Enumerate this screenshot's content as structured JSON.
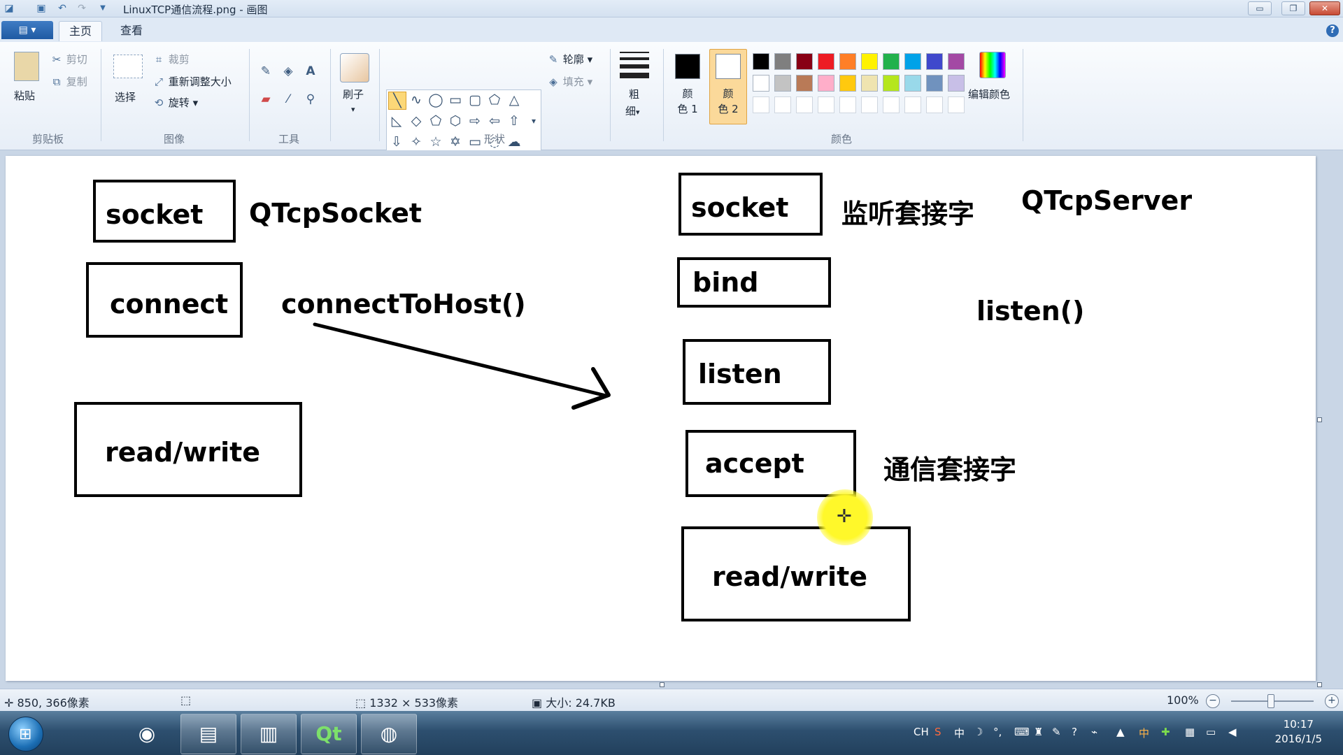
{
  "window": {
    "title": "LinuxTCP通信流程.png - 画图",
    "controls": {
      "minimize": "▭",
      "restore": "❐",
      "close": "✕"
    }
  },
  "quick_access": {
    "icons": [
      "paint-app-icon",
      "save-icon",
      "undo-icon",
      "redo-icon",
      "customize-icon"
    ]
  },
  "tabs": {
    "app_menu": "▤ ▾",
    "home": "主页",
    "view": "查看",
    "help": "?"
  },
  "ribbon": {
    "clipboard": {
      "paste": "粘贴",
      "cut": "剪切",
      "copy": "复制",
      "group": "剪贴板"
    },
    "image": {
      "select": "选择",
      "crop": "裁剪",
      "resize": "重新调整大小",
      "rotate": "旋转",
      "group": "图像"
    },
    "tools": {
      "group": "工具"
    },
    "brushes": {
      "label": "刷子"
    },
    "shapes": {
      "outline": "轮廓",
      "fill": "填充",
      "group": "形状"
    },
    "size": {
      "label_1": "粗",
      "label_2": "细"
    },
    "colors": {
      "color1_line1": "颜",
      "color1_line2": "色 1",
      "color2_line1": "颜",
      "color2_line2": "色 2",
      "edit": "编辑颜色",
      "group": "颜色",
      "color1": "#000000",
      "color2": "#ffffff",
      "palette_row1": [
        "#000000",
        "#7f7f7f",
        "#880015",
        "#ed1c24",
        "#ff7f27",
        "#fff200",
        "#22b14c",
        "#00a2e8",
        "#3f48cc",
        "#a349a4"
      ],
      "palette_row2": [
        "#ffffff",
        "#c3c3c3",
        "#b97a57",
        "#ffaec9",
        "#ffc90e",
        "#efe4b0",
        "#b5e61d",
        "#99d9ea",
        "#7092be",
        "#c8bfe7"
      ]
    }
  },
  "canvas": {
    "client": {
      "socket": "socket",
      "socket_note": "QTcpSocket",
      "connect": "connect",
      "connect_note": "connectToHost()",
      "readwrite": "read/write"
    },
    "server": {
      "socket": "socket",
      "socket_note": "监听套接字",
      "class_note": "QTcpServer",
      "bind": "bind",
      "listen": "listen",
      "listen_note": "listen()",
      "accept": "accept",
      "accept_note": "通信套接字",
      "readwrite": "read/write"
    }
  },
  "statusbar": {
    "position": "850, 366像素",
    "dimensions": "1332 × 533像素",
    "filesize": "大小: 24.7KB",
    "zoom": "100%"
  },
  "taskbar": {
    "apps": [
      "browser-icon",
      "file-explorer-icon",
      "task-monitor-icon",
      "qt-creator-icon",
      "paint-icon"
    ],
    "tray": {
      "lang": "CH",
      "ime": "中"
    },
    "time": "10:17",
    "date": "2016/1/5"
  }
}
